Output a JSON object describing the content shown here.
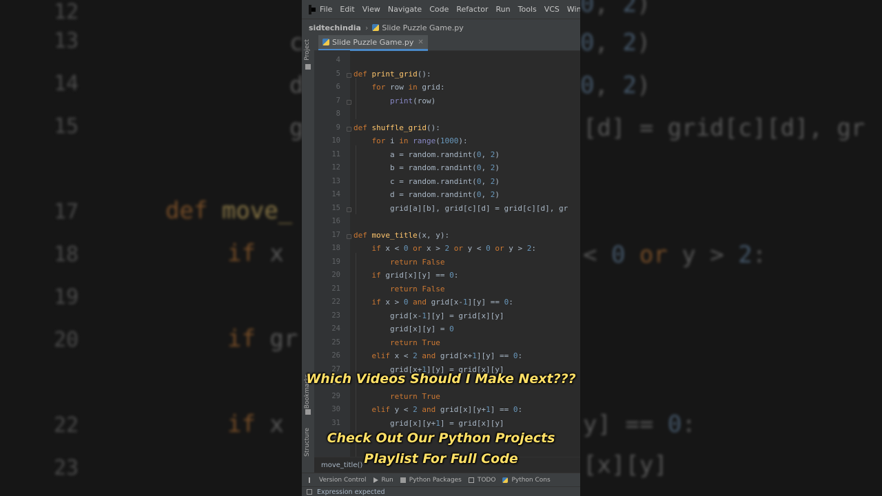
{
  "menu": {
    "items": [
      "File",
      "Edit",
      "View",
      "Navigate",
      "Code",
      "Refactor",
      "Run",
      "Tools",
      "VCS",
      "Window"
    ]
  },
  "breadcrumb": {
    "project": "sidtechindia",
    "file": "Slide Puzzle Game.py"
  },
  "editor": {
    "tab_label": "Slide Puzzle Game.py",
    "current_function": "move_title()",
    "lines": [
      {
        "n": "4",
        "html": ""
      },
      {
        "n": "5",
        "html": "<span class='t-kw'>def</span> <span class='t-fn'>print_grid</span>():"
      },
      {
        "n": "6",
        "html": "    <span class='t-kw'>for</span> row <span class='t-kw'>in</span> grid:"
      },
      {
        "n": "7",
        "html": "        <span class='t-bl'>print</span>(row)"
      },
      {
        "n": "8",
        "html": ""
      },
      {
        "n": "9",
        "html": "<span class='t-kw'>def</span> <span class='t-fn'>shuffle_grid</span>():"
      },
      {
        "n": "10",
        "html": "    <span class='t-kw'>for</span> i <span class='t-kw'>in</span> <span class='t-bl'>range</span>(<span class='t-nm'>1000</span>):"
      },
      {
        "n": "11",
        "html": "        a = random.randint(<span class='t-nm'>0</span>, <span class='t-nm'>2</span>)"
      },
      {
        "n": "12",
        "html": "        b = random.randint(<span class='t-nm'>0</span>, <span class='t-nm'>2</span>)"
      },
      {
        "n": "13",
        "html": "        c = random.randint(<span class='t-nm'>0</span>, <span class='t-nm'>2</span>)"
      },
      {
        "n": "14",
        "html": "        d = random.randint(<span class='t-nm'>0</span>, <span class='t-nm'>2</span>)"
      },
      {
        "n": "15",
        "html": "        grid[a][b], grid[c][d] = grid[c][d], gr"
      },
      {
        "n": "16",
        "html": ""
      },
      {
        "n": "17",
        "html": "<span class='t-kw'>def</span> <span class='t-fn'>move_title</span>(x, y):"
      },
      {
        "n": "18",
        "html": "    <span class='t-kw'>if</span> x &lt; <span class='t-nm'>0</span> <span class='t-kw'>or</span> x &gt; <span class='t-nm'>2</span> <span class='t-kw'>or</span> y &lt; <span class='t-nm'>0</span> <span class='t-kw'>or</span> y &gt; <span class='t-nm'>2</span>:"
      },
      {
        "n": "19",
        "html": "        <span class='t-kw'>return False</span>"
      },
      {
        "n": "20",
        "html": "    <span class='t-kw'>if</span> grid[x][y] == <span class='t-nm'>0</span>:"
      },
      {
        "n": "21",
        "html": "        <span class='t-kw'>return False</span>"
      },
      {
        "n": "22",
        "html": "    <span class='t-kw'>if</span> x &gt; <span class='t-nm'>0</span> <span class='t-kw'>and</span> grid[x-<span class='t-nm'>1</span>][y] == <span class='t-nm'>0</span>:"
      },
      {
        "n": "23",
        "html": "        grid[x-<span class='t-nm'>1</span>][y] = grid[x][y]"
      },
      {
        "n": "24",
        "html": "        grid[x][y] = <span class='t-nm'>0</span>"
      },
      {
        "n": "25",
        "html": "        <span class='t-kw'>return True</span>"
      },
      {
        "n": "26",
        "html": "    <span class='t-kw'>elif</span> x &lt; <span class='t-nm'>2</span> <span class='t-kw'>and</span> grid[x+<span class='t-nm'>1</span>][y] == <span class='t-nm'>0</span>:"
      },
      {
        "n": "27",
        "html": "        grid[x+<span class='t-nm'>1</span>][y] = grid[x][y]"
      },
      {
        "n": "28",
        "html": ""
      },
      {
        "n": "29",
        "html": "        <span class='t-kw'>return True</span>"
      },
      {
        "n": "30",
        "html": "    <span class='t-kw'>elif</span> y &lt; <span class='t-nm'>2</span> <span class='t-kw'>and</span> grid[x][y+<span class='t-nm'>1</span>] == <span class='t-nm'>0</span>:"
      },
      {
        "n": "31",
        "html": "        grid[x][y+<span class='t-nm'>1</span>] = grid[x][y]"
      },
      {
        "n": "32",
        "html": ""
      }
    ]
  },
  "toolbar": {
    "items": [
      "Version Control",
      "Run",
      "Python Packages",
      "TODO",
      "Python Cons"
    ]
  },
  "status": {
    "message": "Expression expected"
  },
  "side_labels": {
    "project": "Project",
    "bookmarks": "Bookmarks",
    "structure": "Structure"
  },
  "overlay": {
    "question": "Which Videos Should I Make Next???",
    "cta_line1": "Check Out Our Python Projects",
    "cta_line2": "Playlist For Full Code"
  },
  "colors": {
    "caption": "#ffe066",
    "keyword": "#cc7832",
    "function": "#ffc66d",
    "number": "#6897bb",
    "editor_bg": "#2b2b2b"
  }
}
